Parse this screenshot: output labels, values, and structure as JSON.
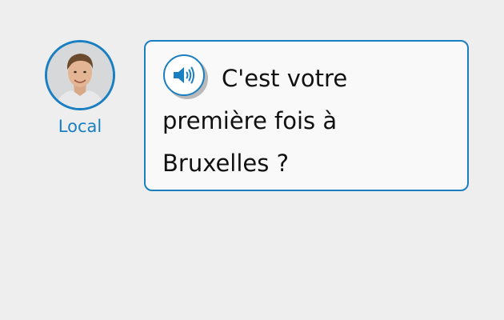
{
  "speaker": {
    "name": "Local",
    "avatar_icon": "person-photo",
    "accent_color": "#1a7fc1"
  },
  "message": {
    "text": "C'est votre première fois à Bruxelles ?",
    "audio_icon": "speaker-icon"
  },
  "colors": {
    "background": "#eeeeee",
    "bubble_bg": "#f9f9f9",
    "accent": "#1a7fc1",
    "text": "#111111"
  }
}
